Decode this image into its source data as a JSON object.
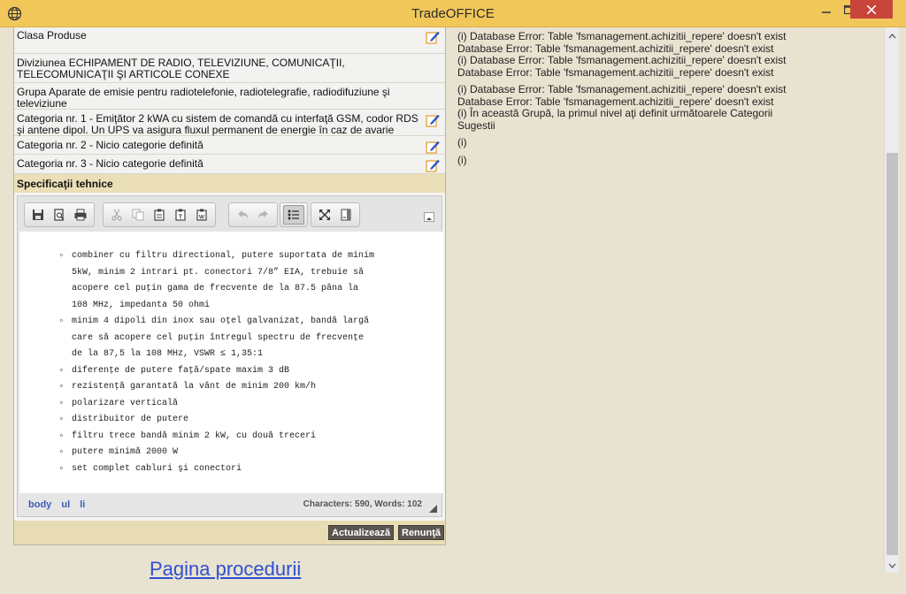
{
  "window": {
    "title": "TradeOFFICE"
  },
  "rows": [
    {
      "text": "Clasa Produse",
      "editable": true
    },
    {
      "text": "Diviziunea ECHIPAMENT DE RADIO, TELEVIZIUNE, COMUNICAŢII, TELECOMUNICAŢII ŞI ARTICOLE CONEXE",
      "editable": false
    },
    {
      "text": "Grupa Aparate de emisie pentru radiotelefonie, radiotelegrafie, radiodifuziune şi televiziune",
      "editable": false
    },
    {
      "text": "Categoria nr. 1 -  Emiţător 2 kWA cu sistem de comandă cu interfaţă GSM, codor RDS şi antene dipol. Un UPS va asigura fluxul permanent de energie în caz de avarie",
      "editable": true
    },
    {
      "text": "Categoria nr. 2 -  Nicio categorie definită",
      "editable": true
    },
    {
      "text": "Categoria nr. 3 -  Nicio categorie definită",
      "editable": true
    }
  ],
  "spec": {
    "header": "Specificaţii tehnice"
  },
  "editor": {
    "toolbar_groups": [
      [
        "save-icon",
        "preview-icon",
        "print-icon"
      ],
      [
        "cut-icon",
        "copy-icon",
        "paste-icon",
        "paste-text-icon",
        "paste-word-icon"
      ],
      [
        "undo-icon",
        "redo-icon"
      ],
      [
        "bulleted-list-icon"
      ],
      [
        "maximize-icon",
        "show-blocks-icon"
      ]
    ],
    "items": [
      "combiner cu filtru directional, putere suportata de minim\n5kW, minim 2 intrari pt. conectori 7/8” EIA, trebuie să\nacopere cel puţin gama de frecvente de la 87.5 pâna la\n108 MHz, impedanta 50 ohmi",
      "minim 4 dipoli din inox sau oţel galvanizat, bandă largă\ncare să acopere cel puţin întregul spectru de frecvenţe\nde la 87,5 la 108 MHz, VSWR ≤ 1,35:1",
      "diferenţe de putere faţă/spate maxim 3 dB",
      "rezistenţă garantată la vânt de minim 200 km/h",
      "polarizare verticală",
      "distribuitor de putere",
      "filtru trece bandă minim 2 kW, cu două treceri",
      "putere minimă 2000 W",
      "set complet cabluri şi conectori"
    ],
    "path": [
      "body",
      "ul",
      "li"
    ],
    "counts": "Characters: 590, Words: 102"
  },
  "actions": {
    "update": "Actualizează",
    "cancel": "Renunţă"
  },
  "procedure_link": "Pagina procedurii",
  "log": [
    "(i) Database Error: Table 'fsmanagement.achizitii_repere' doesn't exist",
    "Database Error: Table 'fsmanagement.achizitii_repere' doesn't exist",
    "(i) Database Error: Table 'fsmanagement.achizitii_repere' doesn't exist",
    "Database Error: Table 'fsmanagement.achizitii_repere' doesn't exist",
    "(i) Database Error: Table 'fsmanagement.achizitii_repere' doesn't exist",
    "Database Error: Table 'fsmanagement.achizitii_repere' doesn't exist",
    "(i) În această Grupă, la primul nivel aţi definit următoarele Categorii",
    "Sugestii",
    "(i)",
    "(i)"
  ],
  "colors": {
    "titlebar": "#f1c75a",
    "close": "#c7453a",
    "link": "#2f4fd1",
    "path": "#3d5bb8"
  }
}
